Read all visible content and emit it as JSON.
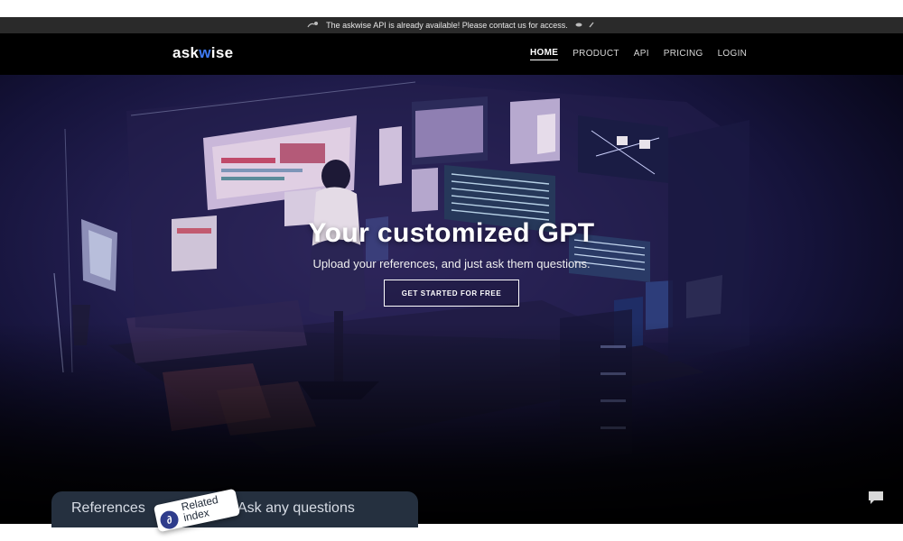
{
  "announcement": {
    "text": "The askwise API is already available! Please contact us for access.",
    "lead_icon": "satellite-icon",
    "trail_icon": "signal-icon"
  },
  "nav": {
    "logo_left": "ask",
    "logo_accent": "w",
    "logo_right": "ise",
    "links": [
      "HOME",
      "PRODUCT",
      "API",
      "PRICING",
      "LOGIN"
    ],
    "active": "HOME"
  },
  "hero": {
    "title": "Your customized GPT",
    "subtitle": "Upload your references, and just ask them questions.",
    "cta": "GET STARTED FOR FREE"
  },
  "feature_card": {
    "left_text": "References",
    "right_text": "Ask any questions",
    "tag_icon": "link-icon",
    "tag_text": "Related index"
  },
  "chat_widget": {
    "icon": "chat-bubble-icon"
  },
  "colors": {
    "logo_accent": "#3f7bf5",
    "announce_bg": "#2a2a2a",
    "nav_bg": "#000000",
    "card_bg": "#25303f"
  }
}
